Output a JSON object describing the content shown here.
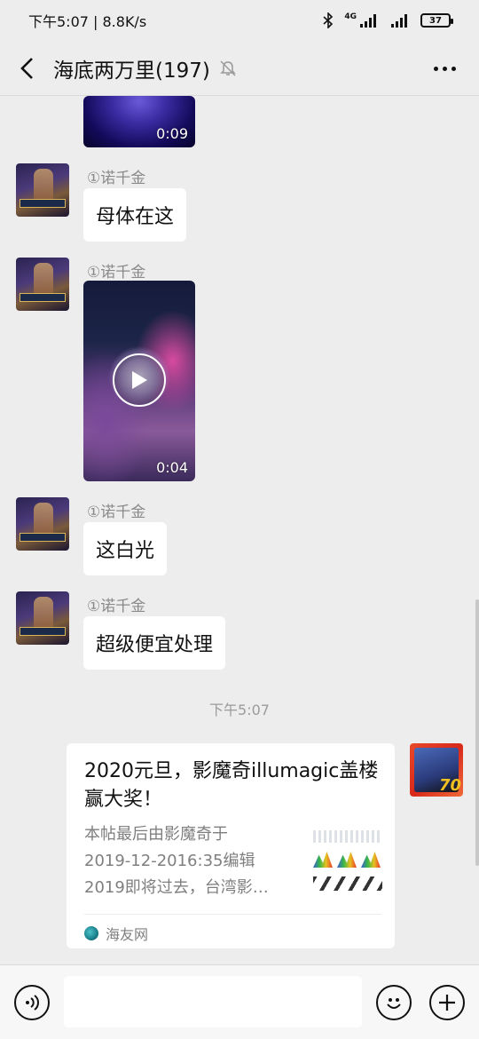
{
  "status_bar": {
    "time_speed": "下午5:07 | 8.8K/s",
    "network": "4G",
    "battery": "37"
  },
  "header": {
    "title": "海底两万里(197)"
  },
  "messages": [
    {
      "type": "video",
      "duration": "0:09"
    },
    {
      "type": "text",
      "sender": "①诺千金",
      "text": "母体在这"
    },
    {
      "type": "video",
      "sender": "①诺千金",
      "duration": "0:04"
    },
    {
      "type": "text",
      "sender": "①诺千金",
      "text": "这白光"
    },
    {
      "type": "text",
      "sender": "①诺千金",
      "text": "超级便宜处理"
    }
  ],
  "time_divider": "下午5:07",
  "link_card": {
    "title": "2020元旦，影魔奇illumagic盖楼赢大奖！",
    "desc_lines": [
      "本帖最后由影魔奇于",
      "2019-12-2016:35编辑",
      "2019即将过去，台湾影…"
    ],
    "source": "海友网"
  },
  "my_avatar_badge": "70",
  "colors": {
    "background": "#ededed",
    "bubble": "#ffffff",
    "muted_text": "#8a8a8a"
  }
}
